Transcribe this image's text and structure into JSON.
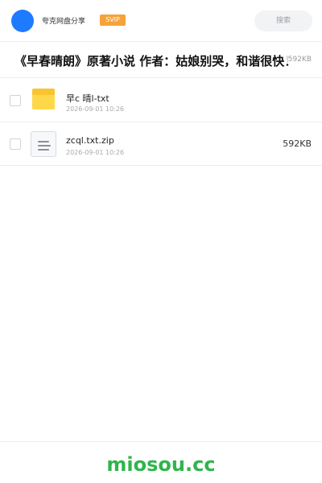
{
  "header": {
    "app_name": "夸克网盘分享",
    "badge": "SVIP",
    "search_placeholder": "搜索"
  },
  "share": {
    "title": "《早春晴朗》原著小说 作者：姑娘别哭，和谐很快！",
    "size": "592KB"
  },
  "files": [
    {
      "name": "早c 晴l-txt",
      "date": "2026-09-01 10:26",
      "size": "",
      "type": "folder"
    },
    {
      "name": "zcql.txt.zip",
      "date": "2026-09-01 10:26",
      "size": "592KB",
      "type": "zip"
    }
  ],
  "footer": {
    "brand": "miosou.cc"
  },
  "colors": {
    "avatar": "#1e7bff",
    "svip_badge": "#f6a23a",
    "folder": "#ffd84a",
    "brand": "#2fb54c"
  },
  "icons": {
    "avatar": "avatar-circle",
    "folder": "folder-icon",
    "file": "document-icon"
  }
}
